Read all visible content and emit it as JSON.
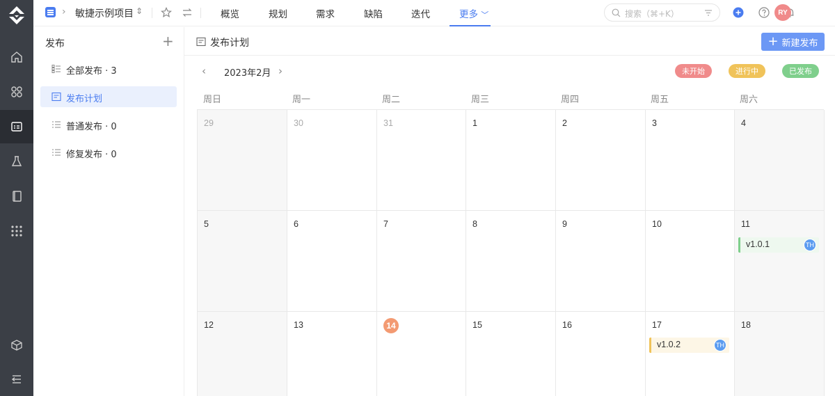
{
  "topbar": {
    "project_name": "敏捷示例项目",
    "nav": [
      "概览",
      "规划",
      "需求",
      "缺陷",
      "迭代",
      "更多"
    ],
    "search_placeholder": "搜索（⌘+K）",
    "user_initials": "RY"
  },
  "sidebar": {
    "title": "发布",
    "items": [
      {
        "label": "全部发布 · 3"
      },
      {
        "label": "发布计划"
      },
      {
        "label": "普通发布 · 0"
      },
      {
        "label": "修复发布 · 0"
      }
    ]
  },
  "main": {
    "title": "发布计划",
    "new_button": "新建发布"
  },
  "calendar": {
    "month": "2023年2月",
    "legend": [
      {
        "label": "未开始",
        "color": "#f08b8b"
      },
      {
        "label": "进行中",
        "color": "#f0c35a"
      },
      {
        "label": "已发布",
        "color": "#7fcf8c"
      }
    ],
    "weekdays": [
      "周日",
      "周一",
      "周二",
      "周三",
      "周四",
      "周五",
      "周六"
    ],
    "weeks": [
      [
        "29",
        "30",
        "31",
        "1",
        "2",
        "3",
        "4"
      ],
      [
        "5",
        "6",
        "7",
        "8",
        "9",
        "10",
        "11"
      ],
      [
        "12",
        "13",
        "14",
        "15",
        "16",
        "17",
        "18"
      ]
    ],
    "today": "14",
    "events": [
      {
        "name": "v1.0.1",
        "assignee": "TH",
        "status_color": "#7fcf8c",
        "bg": "#eef8ef"
      },
      {
        "name": "v1.0.2",
        "assignee": "TH",
        "status_color": "#f0c35a",
        "bg": "#fdf6e6"
      }
    ]
  }
}
